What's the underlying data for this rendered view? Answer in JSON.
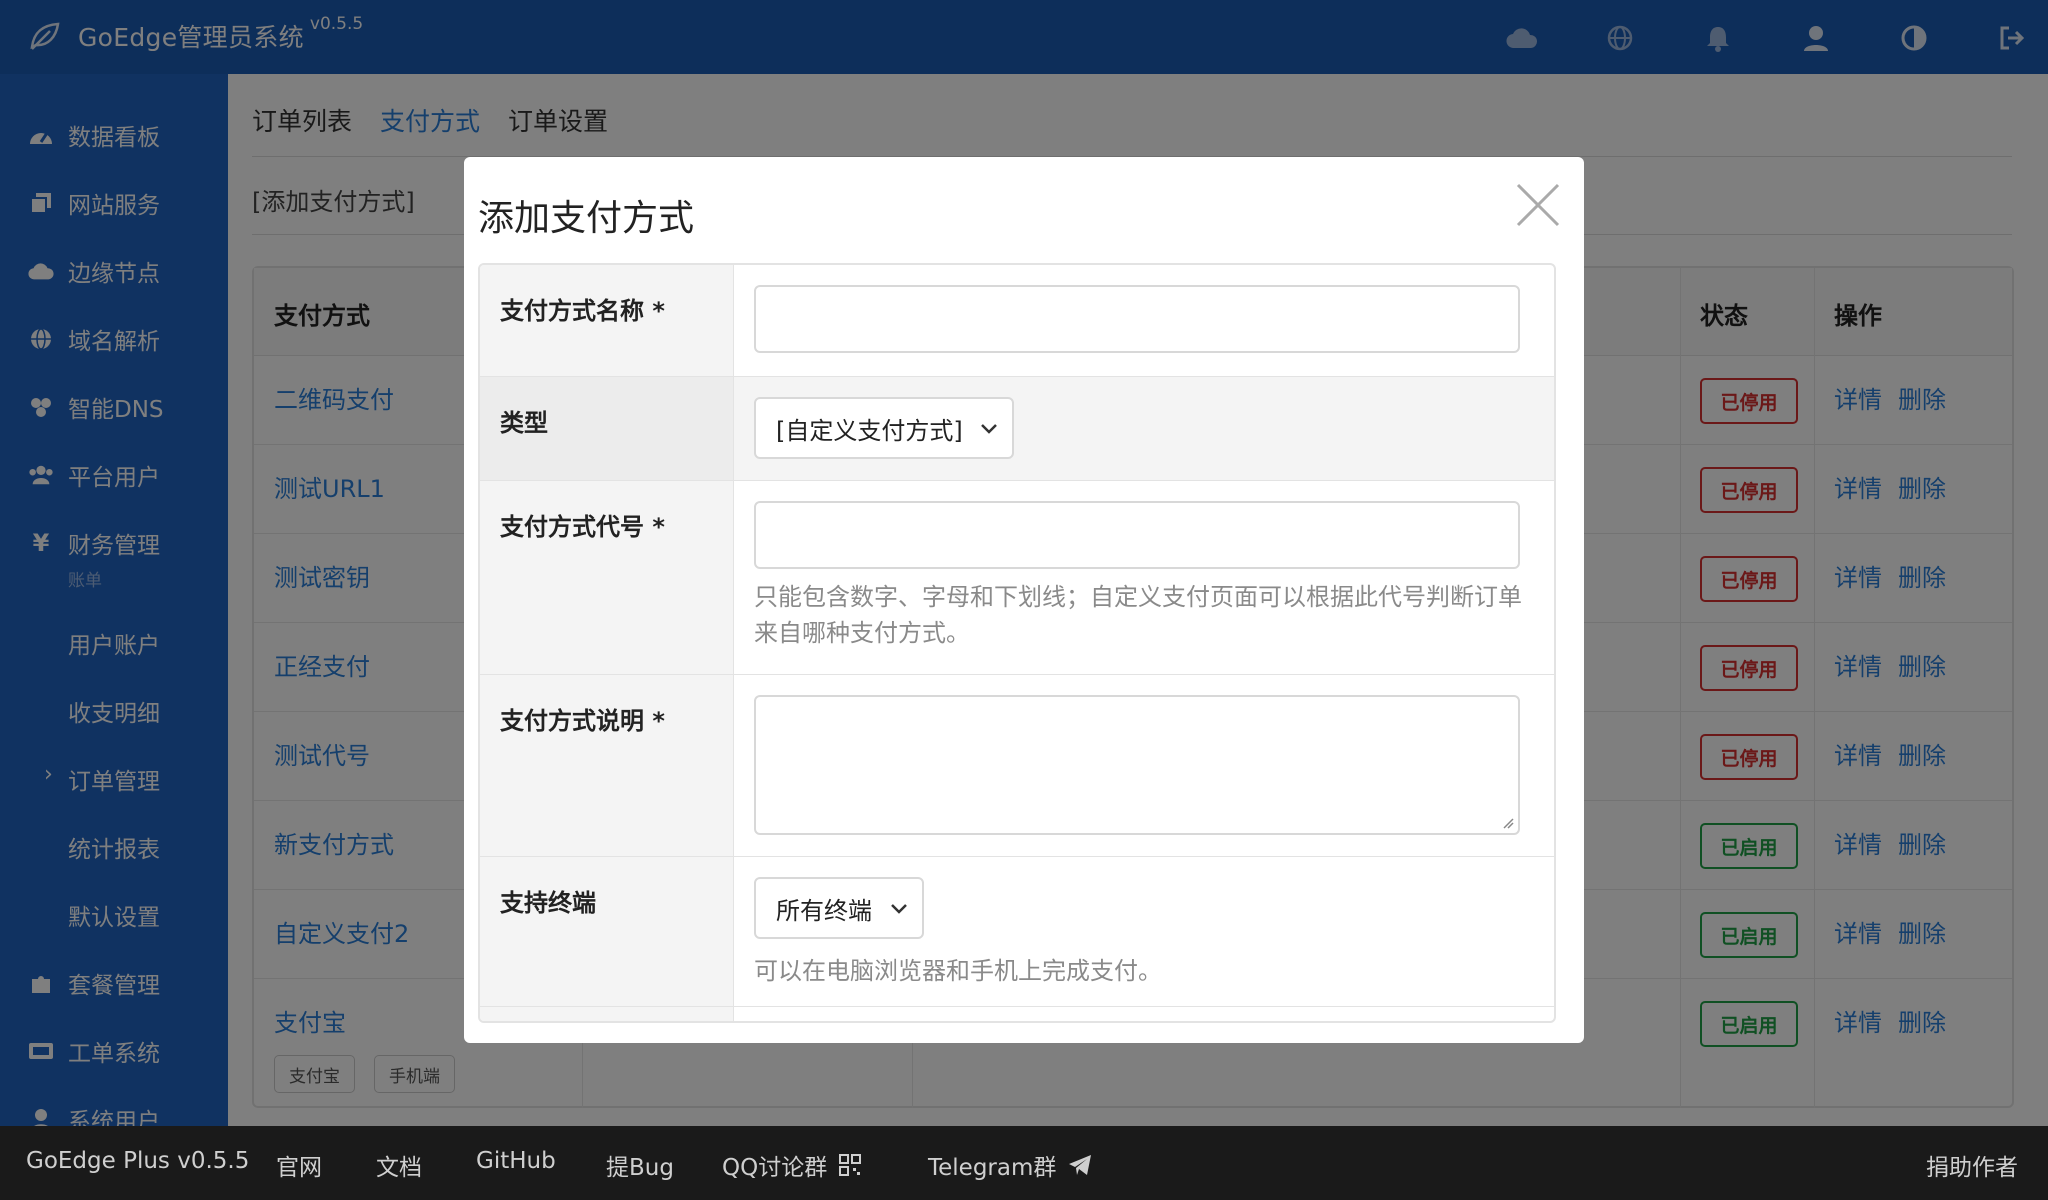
{
  "app": {
    "title": "GoEdge管理员系统",
    "version": "v0.5.5"
  },
  "topbar": {
    "icons": [
      "cloud-icon",
      "globe-icon",
      "bell-icon",
      "user-icon",
      "contrast-icon",
      "logout-icon"
    ]
  },
  "sidebar": {
    "items": [
      {
        "label": "数据看板",
        "icon": "dashboard-icon"
      },
      {
        "label": "网站服务",
        "icon": "sites-icon"
      },
      {
        "label": "边缘节点",
        "icon": "cloud-icon"
      },
      {
        "label": "域名解析",
        "icon": "globe-icon"
      },
      {
        "label": "智能DNS",
        "icon": "dns-icon"
      },
      {
        "label": "平台用户",
        "icon": "users-icon"
      },
      {
        "label": "财务管理",
        "icon": "yen-icon",
        "note": "账单"
      },
      {
        "label": "套餐管理",
        "icon": "puzzle-icon"
      },
      {
        "label": "工单系统",
        "icon": "ticket-icon"
      },
      {
        "label": "系统用户",
        "icon": "user-icon"
      }
    ],
    "sub_items": [
      "用户账户",
      "收支明细",
      "订单管理",
      "统计报表",
      "默认设置"
    ],
    "active_sub": "订单管理"
  },
  "main": {
    "tabs": [
      "订单列表",
      "支付方式",
      "订单设置"
    ],
    "active_tab": "支付方式",
    "add_link": "[添加支付方式]",
    "table": {
      "headers": {
        "name": "支付方式",
        "status": "状态",
        "actions": "操作"
      },
      "rows": [
        {
          "name": "二维码支付",
          "status": "已停用",
          "enabled": false
        },
        {
          "name": "测试URL1",
          "status": "已停用",
          "enabled": false
        },
        {
          "name": "测试密钥",
          "status": "已停用",
          "enabled": false
        },
        {
          "name": "正经支付",
          "status": "已停用",
          "enabled": false
        },
        {
          "name": "测试代号",
          "status": "已停用",
          "enabled": false
        },
        {
          "name": "新支付方式",
          "status": "已启用",
          "enabled": true
        },
        {
          "name": "自定义支付2",
          "status": "已启用",
          "enabled": true
        },
        {
          "name": "支付宝",
          "status": "已启用",
          "enabled": true,
          "tags": [
            "支付宝",
            "手机端"
          ]
        }
      ],
      "action_detail": "详情",
      "action_delete": "删除"
    }
  },
  "modal": {
    "title": "添加支付方式",
    "fields": {
      "name_label": "支付方式名称 *",
      "name_value": "",
      "type_label": "类型",
      "type_value": "[自定义支付方式]",
      "code_label": "支付方式代号 *",
      "code_value": "",
      "code_hint": "只能包含数字、字母和下划线；自定义支付页面可以根据此代号判断订单来自哪种支付方式。",
      "desc_label": "支付方式说明 *",
      "desc_value": "",
      "client_label": "支持终端",
      "client_value": "所有终端",
      "client_hint": "可以在电脑浏览器和手机上完成支付。"
    }
  },
  "footer": {
    "product": "GoEdge Plus v0.5.5",
    "links": [
      "官网",
      "文档",
      "GitHub",
      "提Bug",
      "QQ讨论群",
      "Telegram群"
    ],
    "donate": "捐助作者"
  },
  "colors": {
    "topbar": "#1b5cb5",
    "sidebar": "#2165c2",
    "link": "#2b7fd8",
    "disabled": "#d63031",
    "enabled": "#21a046"
  }
}
